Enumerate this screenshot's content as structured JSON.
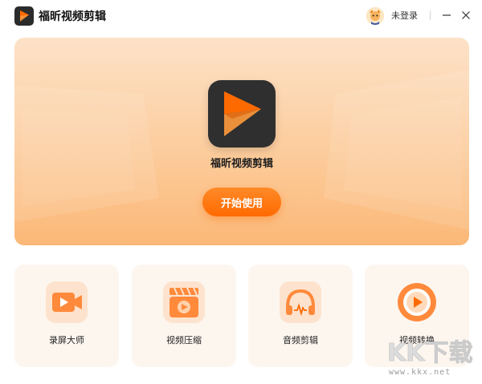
{
  "app": {
    "title": "福昕视频剪辑",
    "brand_color": "#ff6a00"
  },
  "titlebar": {
    "login_label": "未登录",
    "icons": [
      "app-logo-icon",
      "avatar-icon",
      "minimize-icon",
      "close-icon"
    ]
  },
  "hero": {
    "product_name": "福昕视频剪辑",
    "start_label": "开始使用"
  },
  "features": [
    {
      "label": "录屏大师",
      "icon": "screen-record-icon"
    },
    {
      "label": "视频压缩",
      "icon": "video-compress-icon"
    },
    {
      "label": "音频剪辑",
      "icon": "audio-edit-icon"
    },
    {
      "label": "视频转换",
      "icon": "video-convert-icon"
    }
  ],
  "watermark": {
    "text": "KK下载",
    "url": "www.kkx.net"
  }
}
